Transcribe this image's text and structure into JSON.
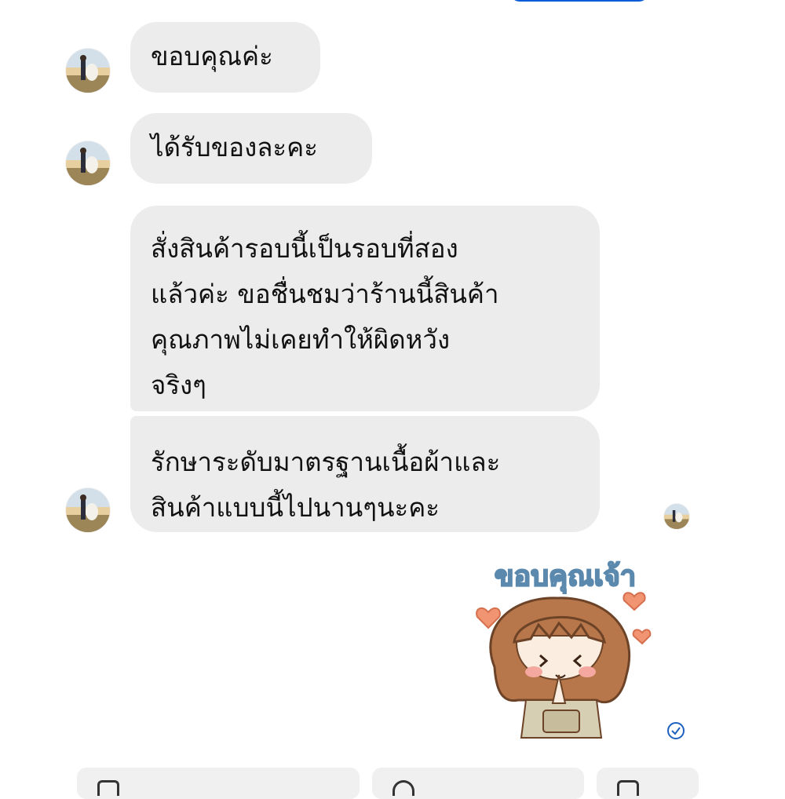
{
  "messages": [
    {
      "id": 1,
      "text": "ขอบคุณค่ะ"
    },
    {
      "id": 2,
      "text": "ได้รับของละคะ"
    },
    {
      "id": 3,
      "text": "สั่งสินค้ารอบนี้เป็นรอบที่สอง\nแล้วค่ะ ขอชื่นชมว่าร้านนี้สินค้า\nคุณภาพไม่เคยทำให้ผิดหวัง\nจริงๆ"
    },
    {
      "id": 4,
      "text": "รักษาระดับมาตรฐานเนื้อผ้าและ\nสินค้าแบบนี้ไปนานๆนะคะ"
    }
  ],
  "sticker": {
    "caption": "ขอบคุณเจ้า",
    "description": "cartoon girl with bangs, hands together, hearts"
  },
  "icons": {
    "avatar": "profile-photo-avatar",
    "seen": "check-circle-icon"
  },
  "colors": {
    "bubble_bg": "#ececec",
    "accent": "#0b5cd9",
    "sticker_text": "#7faac8"
  }
}
